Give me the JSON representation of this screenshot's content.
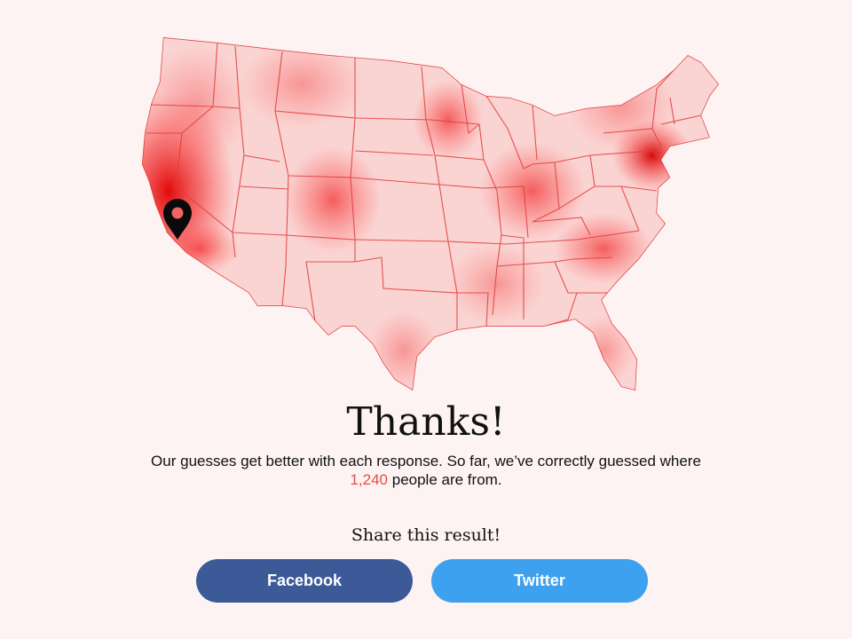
{
  "result": {
    "heading": "Thanks!",
    "message_prefix": "Our guesses get better with each response. So far, we’ve correctly guessed where ",
    "correct_count": "1,240",
    "message_suffix": " people are from."
  },
  "share": {
    "prompt": "Share this result!",
    "facebook_label": "Facebook",
    "twitter_label": "Twitter"
  },
  "map": {
    "marker_icon": "map-pin-icon",
    "heat_color": "#f03a3a",
    "border_color": "#e23a3a"
  },
  "colors": {
    "background": "#fdf3f2",
    "facebook": "#3d5a98",
    "twitter": "#3ea1f0",
    "highlight": "#e74c4c"
  }
}
